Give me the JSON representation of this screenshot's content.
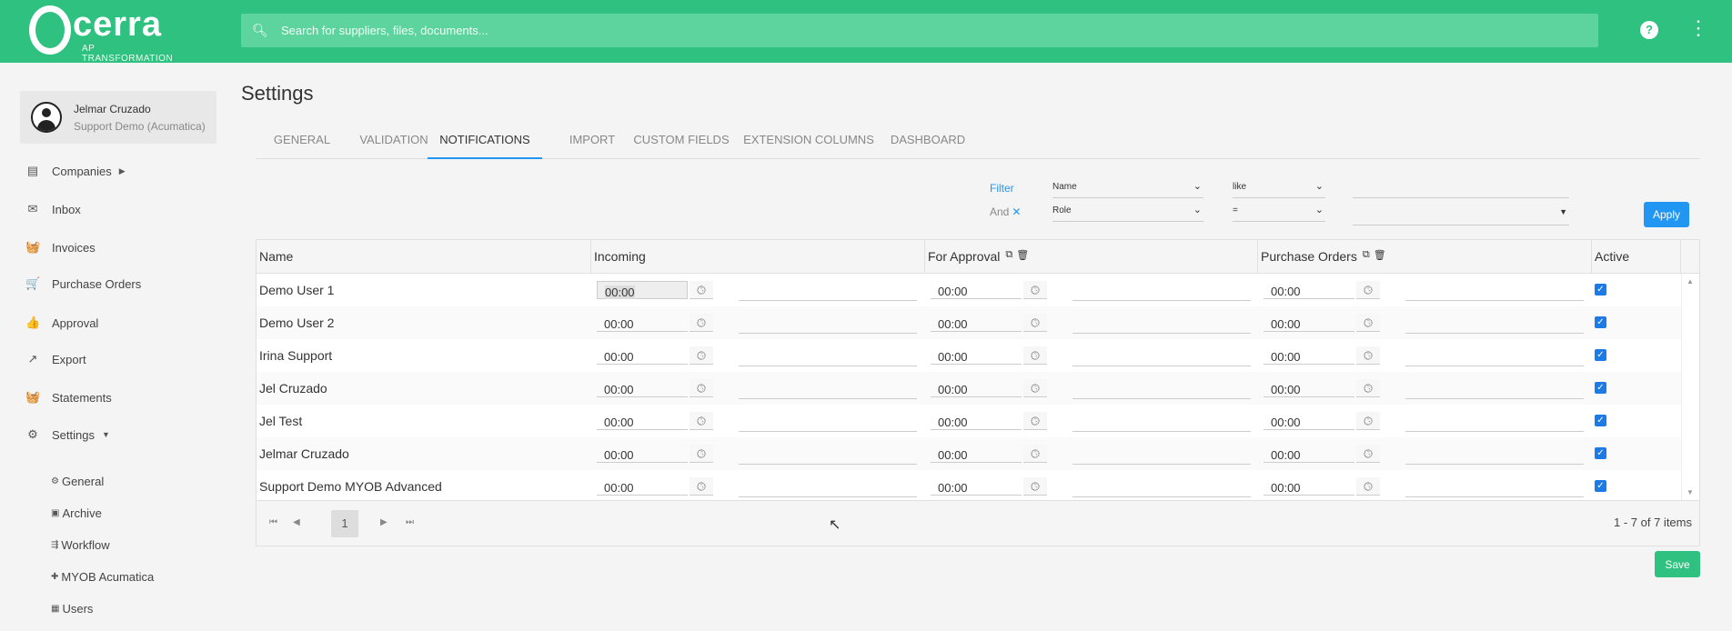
{
  "header": {
    "logo_word": "cerra",
    "logo_tag": "AP TRANSFORMATION",
    "search_placeholder": "Search for suppliers, files, documents...",
    "help": "?",
    "more": "⋮"
  },
  "user": {
    "name": "Jelmar Cruzado",
    "org": "Support Demo (Acumatica)"
  },
  "sidebar": {
    "items": [
      {
        "label": "Companies",
        "icon": "companies-icon",
        "glyph": "▤"
      },
      {
        "label": "Inbox",
        "icon": "inbox-icon",
        "glyph": "✉"
      },
      {
        "label": "Invoices",
        "icon": "basket-icon",
        "glyph": "🧺"
      },
      {
        "label": "Purchase Orders",
        "icon": "cart-icon",
        "glyph": "🛒"
      },
      {
        "label": "Approval",
        "icon": "thumbs-up-icon",
        "glyph": "👍"
      },
      {
        "label": "Export",
        "icon": "export-icon",
        "glyph": "↗"
      },
      {
        "label": "Statements",
        "icon": "basket-icon",
        "glyph": "🧺"
      },
      {
        "label": "Settings",
        "icon": "gear-icon",
        "glyph": "⚙"
      }
    ],
    "sub_items": [
      {
        "label": "General",
        "icon": "gear-icon",
        "glyph": "⚙"
      },
      {
        "label": "Archive",
        "icon": "archive-icon",
        "glyph": "▣"
      },
      {
        "label": "Workflow",
        "icon": "workflow-icon",
        "glyph": "⇶"
      },
      {
        "label": "MYOB Acumatica",
        "icon": "puzzle-icon",
        "glyph": "✚"
      },
      {
        "label": "Users",
        "icon": "users-icon",
        "glyph": "▦"
      }
    ]
  },
  "page": {
    "title": "Settings",
    "tabs": [
      "GENERAL",
      "VALIDATION",
      "NOTIFICATIONS",
      "IMPORT",
      "CUSTOM FIELDS",
      "EXTENSION COLUMNS",
      "DASHBOARD"
    ],
    "active_tab": "NOTIFICATIONS"
  },
  "filter": {
    "label": "Filter",
    "and_label": "And",
    "and_remove": "✕",
    "field1": "Name",
    "op1": "like",
    "field2": "Role",
    "op2": "=",
    "apply": "Apply"
  },
  "grid": {
    "columns": [
      "Name",
      "Incoming",
      "For Approval",
      "Purchase Orders",
      "Active"
    ],
    "rows": [
      {
        "name": "Demo User 1",
        "incoming": "00:00",
        "approval": "00:00",
        "po": "00:00",
        "active": true
      },
      {
        "name": "Demo User 2",
        "incoming": "00:00",
        "approval": "00:00",
        "po": "00:00",
        "active": true
      },
      {
        "name": "Irina Support",
        "incoming": "00:00",
        "approval": "00:00",
        "po": "00:00",
        "active": true
      },
      {
        "name": "Jel Cruzado",
        "incoming": "00:00",
        "approval": "00:00",
        "po": "00:00",
        "active": true
      },
      {
        "name": "Jel Test",
        "incoming": "00:00",
        "approval": "00:00",
        "po": "00:00",
        "active": true
      },
      {
        "name": "Jelmar Cruzado",
        "incoming": "00:00",
        "approval": "00:00",
        "po": "00:00",
        "active": true
      },
      {
        "name": "Support Demo MYOB Advanced",
        "incoming": "00:00",
        "approval": "00:00",
        "po": "00:00",
        "active": true
      }
    ],
    "pager": {
      "page": "1",
      "info": "1 - 7 of 7 items"
    }
  },
  "actions": {
    "save": "Save"
  }
}
